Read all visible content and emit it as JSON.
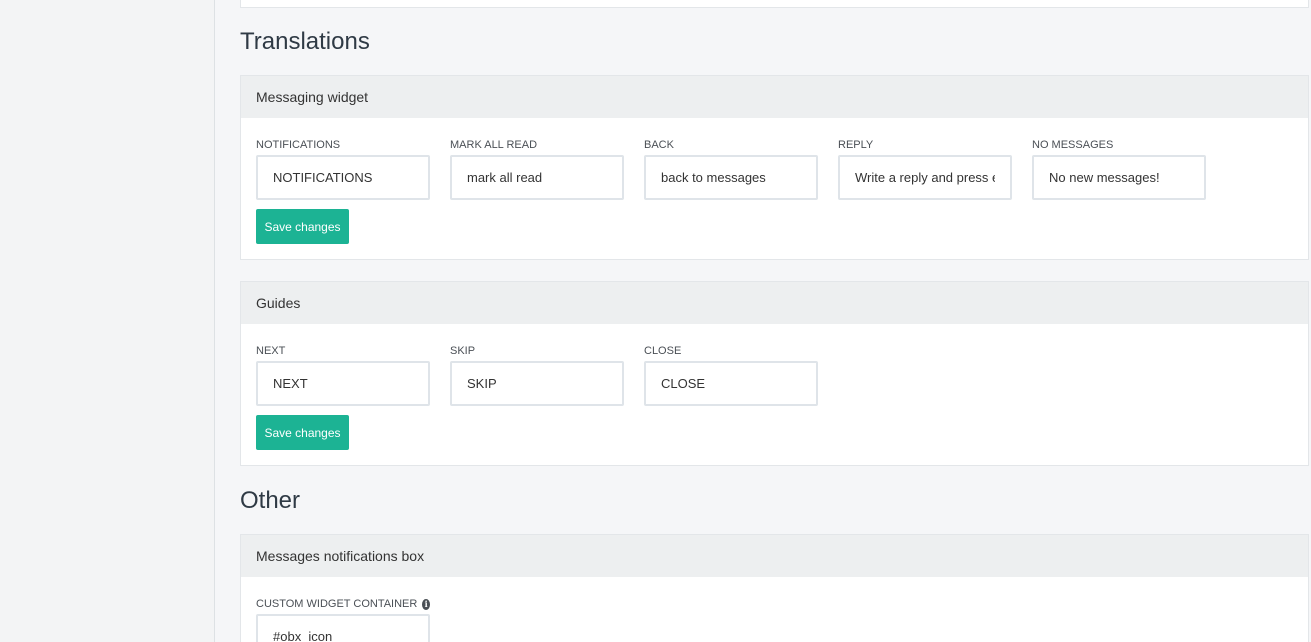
{
  "sections": {
    "translations_title": "Translations",
    "other_title": "Other"
  },
  "messaging_widget": {
    "title": "Messaging widget",
    "fields": [
      {
        "label": "NOTIFICATIONS",
        "value": "NOTIFICATIONS"
      },
      {
        "label": "MARK ALL READ",
        "value": "mark all read"
      },
      {
        "label": "BACK",
        "value": "back to messages"
      },
      {
        "label": "REPLY",
        "value": "Write a reply and press enter"
      },
      {
        "label": "NO MESSAGES",
        "value": "No new messages!"
      }
    ],
    "save_label": "Save changes"
  },
  "guides": {
    "title": "Guides",
    "fields": [
      {
        "label": "NEXT",
        "value": "NEXT"
      },
      {
        "label": "SKIP",
        "value": "SKIP"
      },
      {
        "label": "CLOSE",
        "value": "CLOSE"
      }
    ],
    "save_label": "Save changes"
  },
  "notifications_box": {
    "title": "Messages notifications box",
    "fields": [
      {
        "label": "CUSTOM WIDGET CONTAINER",
        "value": "#obx_icon",
        "icon": "info-icon"
      }
    ]
  },
  "colors": {
    "accent": "#1cb394",
    "page_bg": "#f5f6f8",
    "card_header_bg": "#edeff0"
  }
}
